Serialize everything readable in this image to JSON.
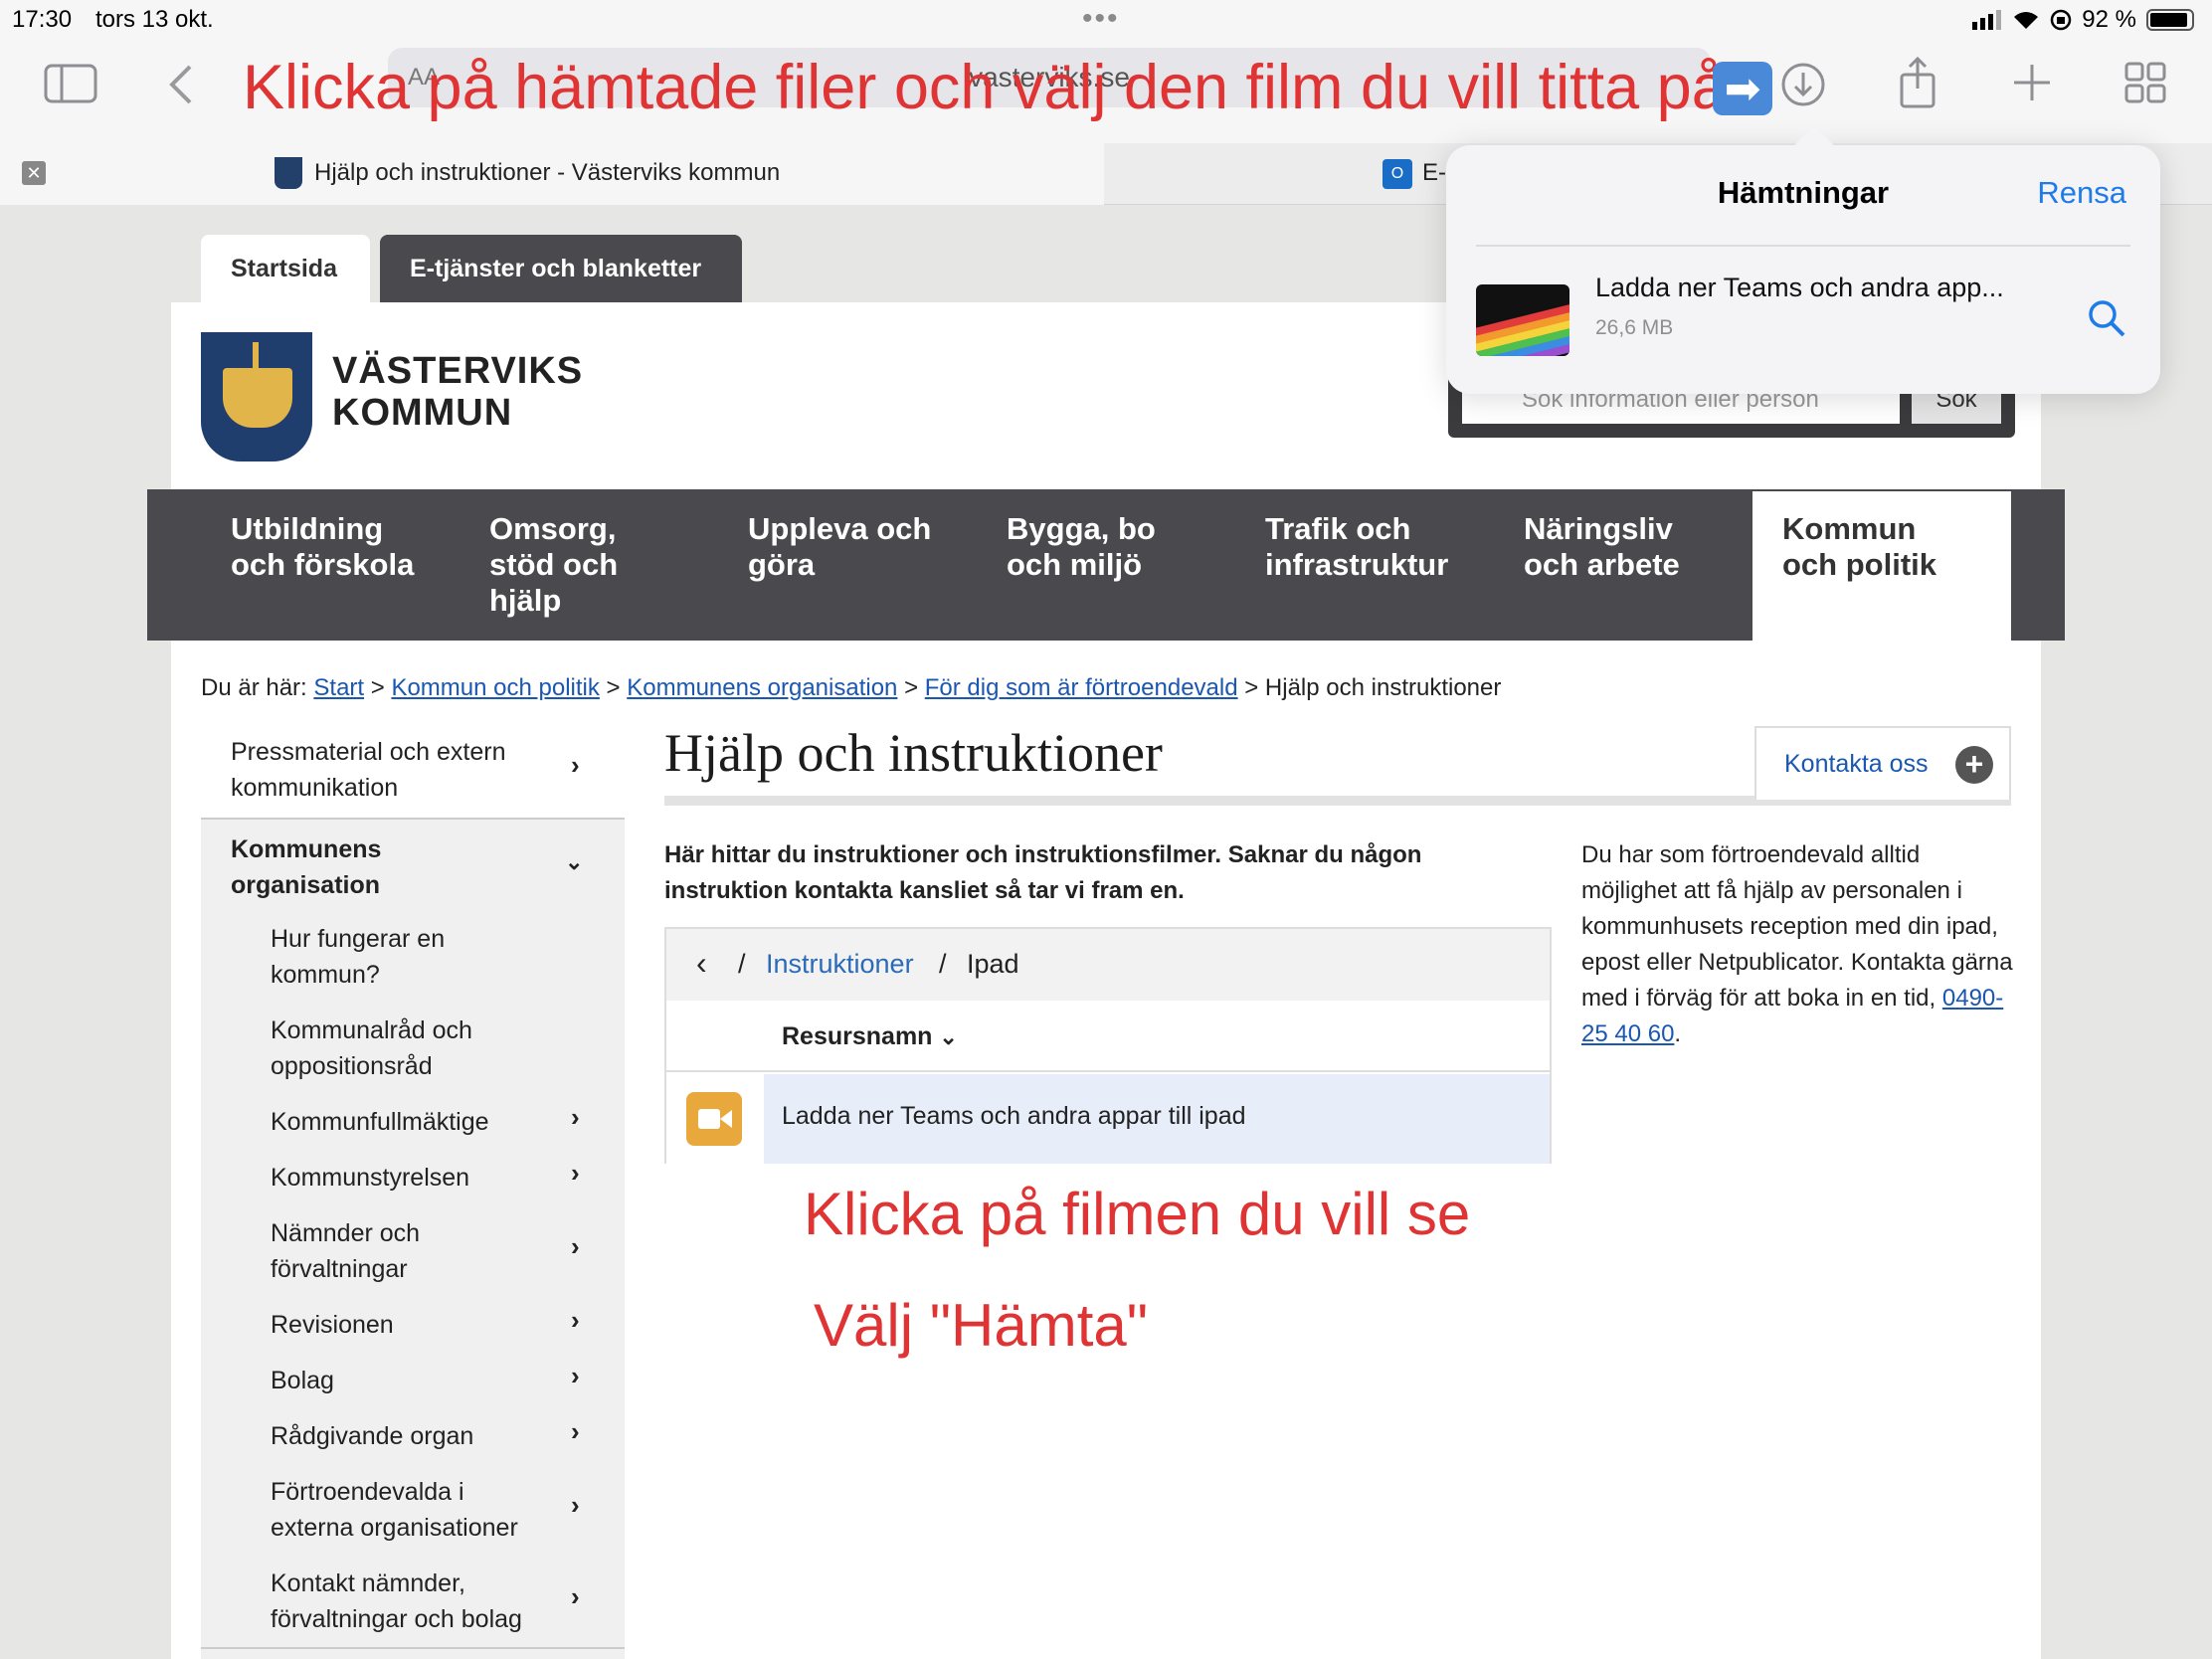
{
  "status": {
    "time": "17:30",
    "date": "tors 13 okt.",
    "battery": "92 %",
    "battery_level": 0.92
  },
  "browser": {
    "address": "vasterviks.se",
    "address_aa": "AA",
    "tabs": [
      {
        "title": "Hjälp och instruktioner - Västerviks kommun"
      },
      {
        "title": "E-"
      }
    ]
  },
  "annotations": {
    "top": "Klicka på hämtade filer och välj den film du vill titta på",
    "middle": "Klicka på filmen du vill se",
    "bottom": "Välj \"Hämta\"",
    "arrow": "➡"
  },
  "site": {
    "tabs": [
      "Startsida",
      "E-tjänster och blanketter"
    ],
    "brand_line1": "VÄSTERVIKS",
    "brand_line2": "KOMMUN",
    "search_placeholder": "Sök information eller person",
    "search_button": "Sök",
    "nav": [
      {
        "l1": "Utbildning",
        "l2": "och förskola",
        "l3": ""
      },
      {
        "l1": "Omsorg,",
        "l2": "stöd och",
        "l3": "hjälp"
      },
      {
        "l1": "Uppleva och",
        "l2": "göra",
        "l3": ""
      },
      {
        "l1": "Bygga, bo",
        "l2": "och miljö",
        "l3": ""
      },
      {
        "l1": "Trafik och",
        "l2": "infrastruktur",
        "l3": ""
      },
      {
        "l1": "Näringsliv",
        "l2": "och arbete",
        "l3": ""
      },
      {
        "l1": "Kommun",
        "l2": "och politik",
        "l3": ""
      }
    ],
    "breadcrumb": {
      "prefix": "Du är här:",
      "links": [
        "Start",
        "Kommun och politik",
        "Kommunens organisation",
        "För dig som är förtroendevald"
      ],
      "current": "Hjälp och instruktioner",
      "sep": ">"
    },
    "sidenav": {
      "top_item": [
        "Pressmaterial och extern",
        "kommunikation"
      ],
      "section": [
        "Kommunens",
        "organisation"
      ],
      "items": [
        [
          "Hur fungerar en",
          "kommun?"
        ],
        [
          "Kommunalråd och",
          "oppositionsråd"
        ],
        [
          "Kommunfullmäktige",
          ""
        ],
        [
          "Kommunstyrelsen",
          ""
        ],
        [
          "Nämnder och",
          "förvaltningar"
        ],
        [
          "Revisionen",
          ""
        ],
        [
          "Bolag",
          ""
        ],
        [
          "Rådgivande organ",
          ""
        ],
        [
          "Förtroendevalda i",
          "externa organisationer"
        ],
        [
          "Kontakt nämnder,",
          "förvaltningar och bolag"
        ]
      ]
    },
    "heading": "Hjälp och instruktioner",
    "contact_button": "Kontakta oss",
    "intro": "Här hittar du instruktioner och instruktionsfilmer. Saknar du någon instruktion kontakta kansliet så tar vi fram en.",
    "aside_text": "Du har som förtroendevald alltid möjlighet att få hjälp av personalen i kommunhusets reception med din ipad, epost eller Netpublicator. Kontakta gärna med i förväg för att boka in en tid,",
    "aside_phone": "0490-25 40 60",
    "aside_end": ".",
    "files": {
      "path_sep": "/",
      "path_link": "Instruktioner",
      "path_current": "Ipad",
      "column": "Resursnamn",
      "rows": [
        {
          "name": "Ladda ner Teams och andra appar till ipad",
          "icon": "video-icon"
        }
      ]
    }
  },
  "downloads": {
    "title": "Hämtningar",
    "clear": "Rensa",
    "item_name": "Ladda ner Teams och andra app...",
    "item_size": "26,6 MB"
  },
  "colors": {
    "accent": "#1e7be8",
    "annotation": "#e03333",
    "nav_bg": "#4a4a4e",
    "link": "#1a57b0"
  }
}
